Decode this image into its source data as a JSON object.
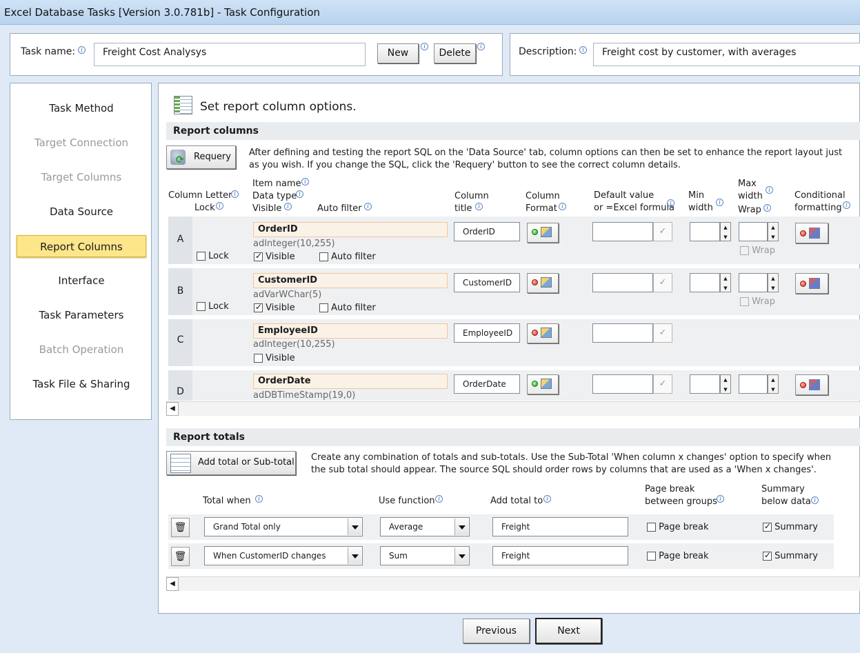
{
  "window": {
    "title": "Excel Database Tasks [Version 3.0.781b] - Task Configuration"
  },
  "header": {
    "task_name_label": "Task name:",
    "task_name_value": "Freight Cost Analysys",
    "new_label": "New",
    "delete_label": "Delete",
    "description_label": "Description:",
    "description_value": "Freight cost by customer, with averages"
  },
  "sidebar": {
    "items": [
      {
        "label": "Task Method"
      },
      {
        "label": "Target Connection"
      },
      {
        "label": "Target Columns"
      },
      {
        "label": "Data Source"
      },
      {
        "label": "Report Columns"
      },
      {
        "label": "Interface"
      },
      {
        "label": "Task Parameters"
      },
      {
        "label": "Batch Operation"
      },
      {
        "label": "Task File & Sharing"
      }
    ]
  },
  "main": {
    "heading": "Set report column options.",
    "report_columns": {
      "section_title": "Report columns",
      "requery_label": "Requery",
      "description_line1": "After defining and testing the report SQL on the 'Data Source' tab, column options can then be set to enhance the report layout just",
      "description_line2": "as you wish. If you change the SQL, click the 'Requery' button to see the correct column details.",
      "headers": {
        "column_letter": "Column Letter",
        "lock": "Lock",
        "item_name": "Item name",
        "data_type": "Data type",
        "visible": "Visible",
        "auto_filter": "Auto filter",
        "column_title_1": "Column",
        "column_title_2": "title",
        "column_format_1": "Column",
        "column_format_2": "Format",
        "default_value_1": "Default value",
        "default_value_2": "or =Excel formula",
        "min_width_1": "Min",
        "min_width_2": "width",
        "max_width_1": "Max",
        "max_width_2": "width",
        "wrap": "Wrap",
        "conditional_1": "Conditional",
        "conditional_2": "formatting"
      },
      "rows": [
        {
          "letter": "A",
          "name": "OrderID",
          "type": "adInteger(10,255)",
          "title": "OrderID",
          "lock_label": "Lock",
          "visible_label": "Visible",
          "autofilter_label": "Auto filter",
          "wrap_label": "Wrap"
        },
        {
          "letter": "B",
          "name": "CustomerID",
          "type": "adVarWChar(5)",
          "title": "CustomerID",
          "lock_label": "Lock",
          "visible_label": "Visible",
          "autofilter_label": "Auto filter",
          "wrap_label": "Wrap"
        },
        {
          "letter": "C",
          "name": "EmployeeID",
          "type": "adInteger(10,255)",
          "title": "EmployeeID",
          "visible_label": "Visible"
        },
        {
          "letter": "D",
          "name": "OrderDate",
          "type": "adDBTimeStamp(19,0)",
          "title": "OrderDate"
        }
      ]
    },
    "report_totals": {
      "section_title": "Report totals",
      "add_label": "Add total or Sub-total",
      "description_line1": "Create any combination of totals and sub-totals.  Use the Sub-Total 'When column x changes' option to specify when",
      "description_line2": "the sub total should appear.  The source SQL should order rows by columns that are used as a 'When x changes'.",
      "headers": {
        "total_when": "Total when",
        "use_function": "Use function",
        "add_total_to": "Add total to",
        "page_break_1": "Page break",
        "page_break_2": "between groups",
        "summary_1": "Summary",
        "summary_2": "below data"
      },
      "rows": [
        {
          "when": "Grand Total only",
          "function": "Average",
          "target": "Freight",
          "page_break_label": "Page break",
          "summary_label": "Summary"
        },
        {
          "when": "When CustomerID changes",
          "function": "Sum",
          "target": "Freight",
          "page_break_label": "Page break",
          "summary_label": "Summary"
        }
      ]
    }
  },
  "footer": {
    "previous_label": "Previous",
    "next_label": "Next"
  }
}
